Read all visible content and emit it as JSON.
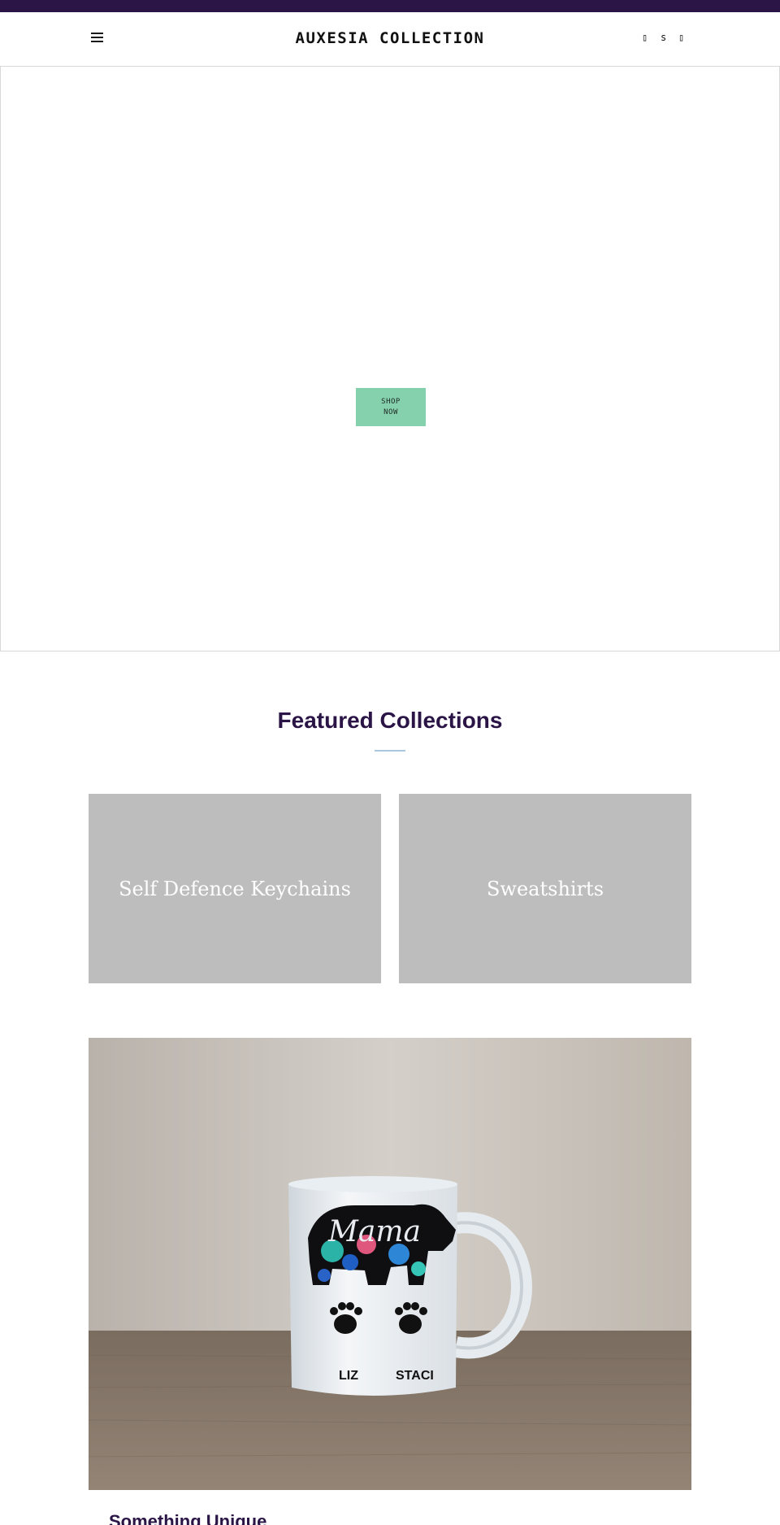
{
  "colors": {
    "brand": "#2a1546",
    "accent_button": "#86d1ad",
    "tile_bg": "#bdbdbd",
    "rule": "#a9c7de"
  },
  "header": {
    "logo_text": "AUXESIA COLLECTION",
    "menu_icon": "hamburger-menu-icon",
    "icons": [
      {
        "name": "search-icon",
        "glyph": "▯"
      },
      {
        "name": "account-icon",
        "glyph": "s"
      },
      {
        "name": "cart-icon",
        "glyph": "▯"
      }
    ]
  },
  "hero": {
    "button_label": "SHOP\nNOW"
  },
  "featured": {
    "title": "Featured Collections",
    "collections": [
      {
        "label": "Self Defence Keychains"
      },
      {
        "label": "Sweatshirts"
      }
    ]
  },
  "feature_block": {
    "image_subject": "mama-bear-mug",
    "mug_text": "Mama",
    "paw_names": [
      "LIZ",
      "STACI"
    ],
    "heading": "Something Unique"
  }
}
